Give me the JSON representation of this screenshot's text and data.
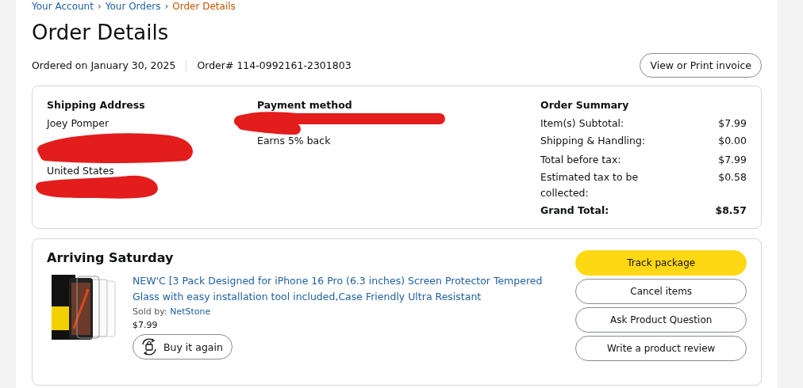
{
  "breadcrumb": [
    {
      "label": "Your Account",
      "current": false
    },
    {
      "label": "Your Orders",
      "current": false
    },
    {
      "label": "Order Details",
      "current": true
    }
  ],
  "breadcrumb_separator": "›",
  "title": "Order Details",
  "ordered_on": "Ordered on January 30, 2025",
  "order_number": "Order# 114-0992161-2301803",
  "invoice_button": "View or Print invoice",
  "shipping": {
    "heading": "Shipping Address",
    "lines": [
      "Joey Pomper",
      "United States"
    ]
  },
  "payment": {
    "heading": "Payment method",
    "note": "Earns 5% back"
  },
  "summary": {
    "heading": "Order Summary",
    "rows": [
      {
        "label": "Item(s) Subtotal:",
        "value": "$7.99",
        "total": false
      },
      {
        "label": "Shipping & Handling:",
        "value": "$0.00",
        "total": false
      },
      {
        "label": "Total before tax:",
        "value": "$7.99",
        "total": false
      },
      {
        "label": "Estimated tax to be collected:",
        "value": "$0.58",
        "total": false
      },
      {
        "label": "Grand Total:",
        "value": "$8.57",
        "total": true
      }
    ]
  },
  "shipment": {
    "heading": "Arriving Saturday",
    "item": {
      "kind": "picture",
      "title": "NEW'C [3 Pack Designed for iPhone 16 Pro (6.3 inches) Screen Protector Tempered Glass with easy installation tool included,Case Friendly Ultra Resistant",
      "sold_by_label": "Sold by:",
      "seller": "NetStone",
      "price": "$7.99",
      "buy_again": "Buy it again"
    },
    "actions": [
      {
        "label": "Track package",
        "kind": "primary"
      },
      {
        "label": "Cancel items",
        "kind": "secondary"
      },
      {
        "label": "Ask Product Question",
        "kind": "secondary"
      },
      {
        "label": "Write a product review",
        "kind": "secondary"
      }
    ]
  }
}
